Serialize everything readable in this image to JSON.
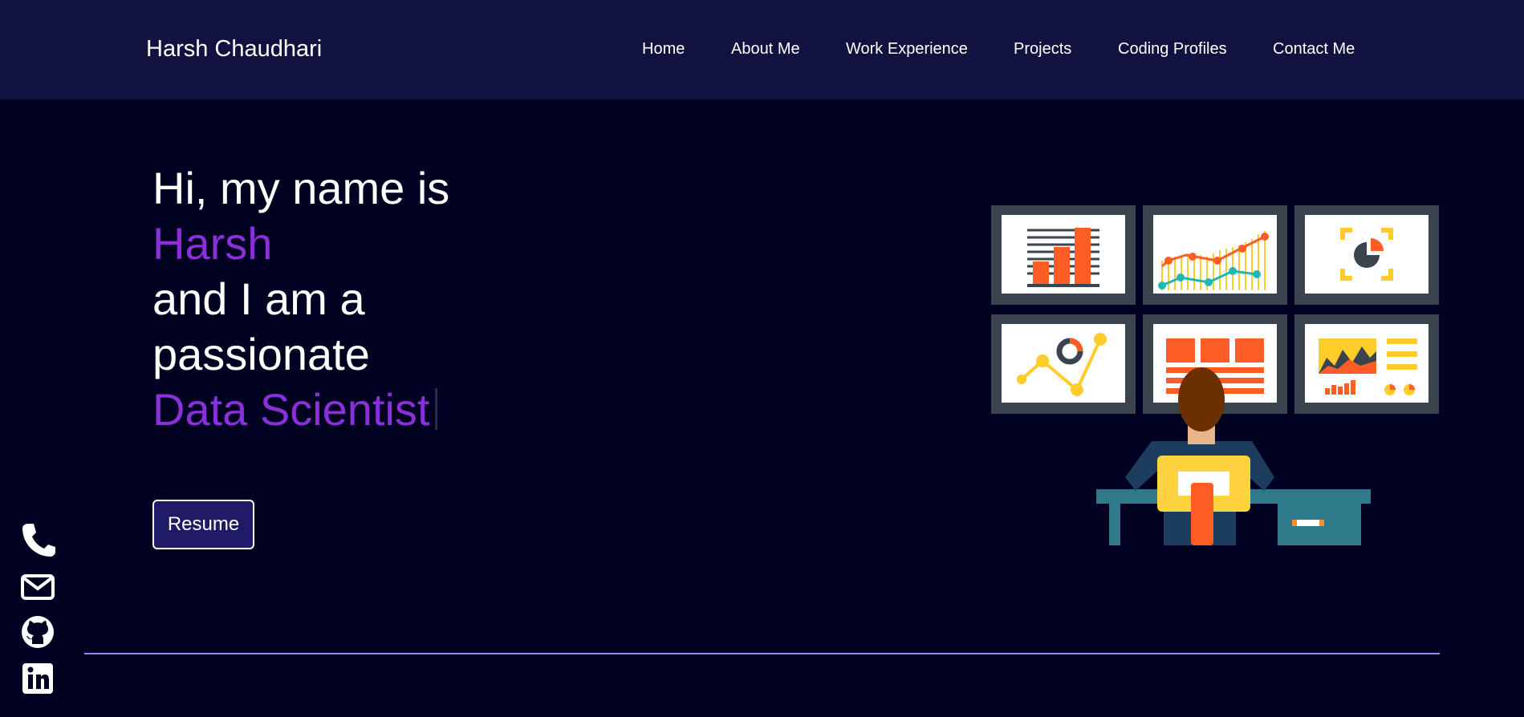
{
  "header": {
    "brand": "Harsh Chaudhari",
    "nav": [
      "Home",
      "About Me",
      "Work Experience",
      "Projects",
      "Coding Profiles",
      "Contact Me"
    ]
  },
  "hero": {
    "line1": "Hi, my name is",
    "name": "Harsh",
    "line3": "and I am a",
    "line4": "passionate",
    "role": "Data Scientist",
    "resume_label": "Resume"
  },
  "social_icons": [
    "phone-icon",
    "mail-icon",
    "github-icon",
    "linkedin-icon"
  ],
  "colors": {
    "background": "#010121",
    "navbar": "#111240",
    "accent": "#8b2fd9",
    "button": "#1f1b66",
    "divider": "#8a8aff"
  }
}
